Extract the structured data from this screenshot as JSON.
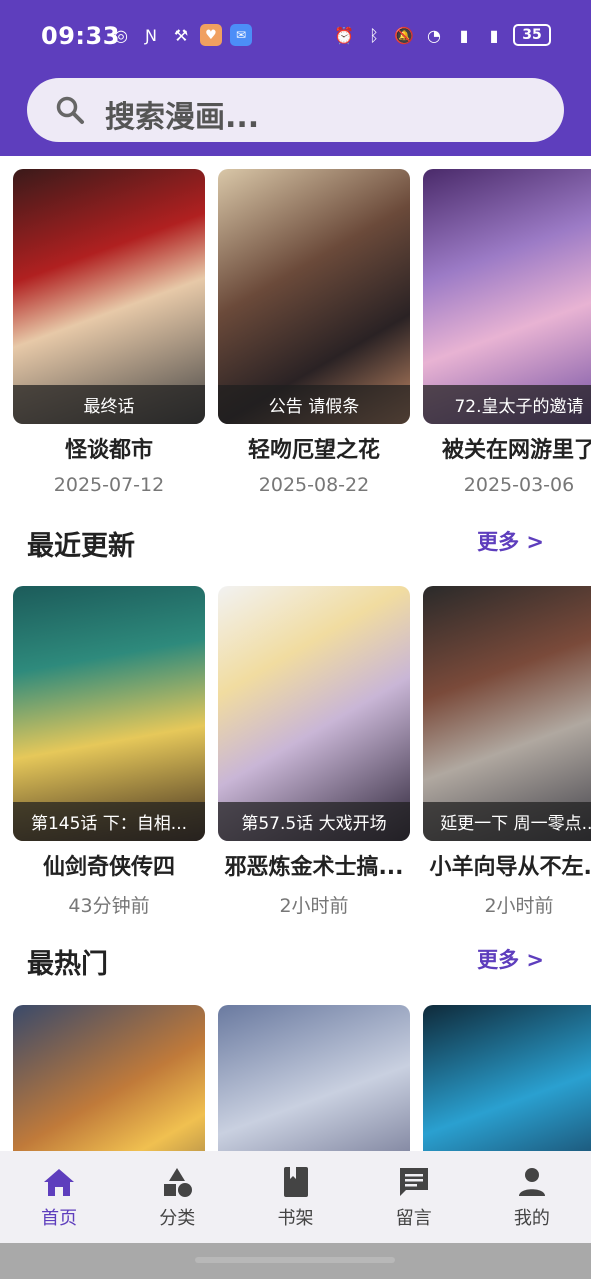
{
  "status": {
    "time": "09:33",
    "battery": "35",
    "left_icons": [
      "data-saver-icon",
      "nfc-icon",
      "app-icon",
      "health-app-icon",
      "mail-app-icon"
    ],
    "right_icons": [
      "alarm-icon",
      "bluetooth-icon",
      "mute-icon",
      "wifi-icon",
      "signal-5g-icon",
      "signal-5g-icon"
    ]
  },
  "search": {
    "placeholder": "搜索漫画..."
  },
  "featured": [
    {
      "caption": "最终话",
      "title": "怪谈都市",
      "sub": "2025-07-12"
    },
    {
      "caption": "公告 请假条",
      "title": "轻吻厄望之花",
      "sub": "2025-08-22"
    },
    {
      "caption": "72.皇太子的邀请",
      "title": "被关在网游里了",
      "sub": "2025-03-06"
    }
  ],
  "recent": {
    "title": "最近更新",
    "more": "更多 >",
    "items": [
      {
        "caption": "第145话 下：自相...",
        "title": "仙剑奇侠传四",
        "sub": "43分钟前"
      },
      {
        "caption": "第57.5话 大戏开场",
        "title": "邪恶炼金术士搞...",
        "sub": "2小时前"
      },
      {
        "caption": "延更一下 周一零点...",
        "title": "小羊向导从不左...",
        "sub": "2小时前"
      }
    ]
  },
  "hot": {
    "title": "最热门",
    "more": "更多 >"
  },
  "nav": [
    {
      "label": "首页",
      "icon": "home-icon"
    },
    {
      "label": "分类",
      "icon": "category-icon"
    },
    {
      "label": "书架",
      "icon": "bookshelf-icon"
    },
    {
      "label": "留言",
      "icon": "message-icon"
    },
    {
      "label": "我的",
      "icon": "profile-icon"
    }
  ],
  "colors": {
    "accent": "#5e3ebd",
    "nav_bg": "#f1f0f4",
    "search_bg": "#eeeaf6"
  }
}
